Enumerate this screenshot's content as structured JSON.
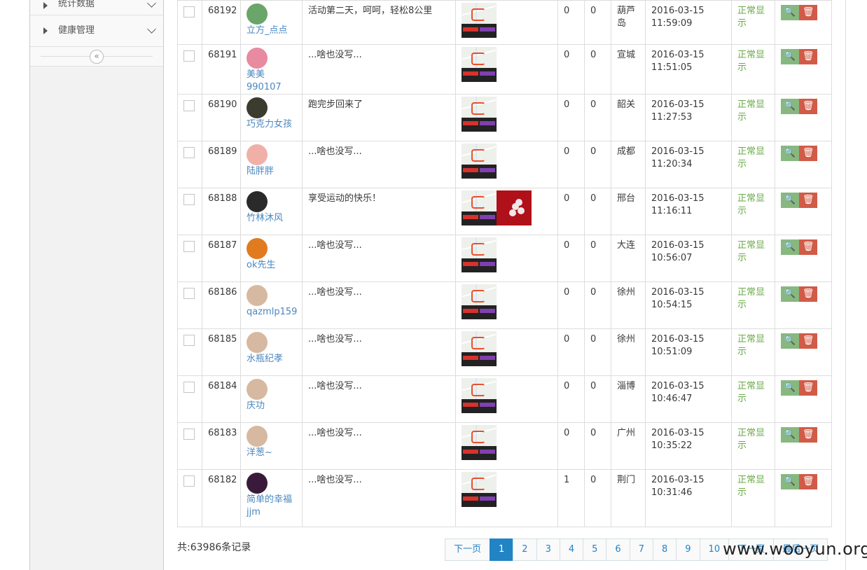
{
  "sidebar": {
    "items": [
      {
        "label": "统计数据"
      },
      {
        "label": "健康管理"
      }
    ],
    "collapse_glyph": "«"
  },
  "rows": [
    {
      "id": "68192",
      "user": "立方_点点",
      "content": "活动第二天，呵呵，轻松8公里",
      "c1": "0",
      "c2": "0",
      "city": "葫芦岛",
      "date": "2016-03-15",
      "time": "11:59:09",
      "status": "正常显示",
      "avatar_color": "#6aa56a",
      "extra_image": false
    },
    {
      "id": "68191",
      "user": "美美990107",
      "content": "...啥也没写...",
      "c1": "0",
      "c2": "0",
      "city": "宣城",
      "date": "2016-03-15",
      "time": "11:51:05",
      "status": "正常显示",
      "avatar_color": "#e88aa0",
      "extra_image": false
    },
    {
      "id": "68190",
      "user": "巧克力女孩",
      "content": "跑完步回来了",
      "c1": "0",
      "c2": "0",
      "city": "韶关",
      "date": "2016-03-15",
      "time": "11:27:53",
      "status": "正常显示",
      "avatar_color": "#3b3b2e",
      "extra_image": false
    },
    {
      "id": "68189",
      "user": "陆胖胖",
      "content": "...啥也没写...",
      "c1": "0",
      "c2": "0",
      "city": "成都",
      "date": "2016-03-15",
      "time": "11:20:34",
      "status": "正常显示",
      "avatar_color": "#f0b0a8",
      "extra_image": false
    },
    {
      "id": "68188",
      "user": "竹林沐风",
      "content": "享受运动的快乐！",
      "c1": "0",
      "c2": "0",
      "city": "邢台",
      "date": "2016-03-15",
      "time": "11:16:11",
      "status": "正常显示",
      "avatar_color": "#2a2a2a",
      "extra_image": true
    },
    {
      "id": "68187",
      "user": "ok先生",
      "content": "...啥也没写...",
      "c1": "0",
      "c2": "0",
      "city": "大连",
      "date": "2016-03-15",
      "time": "10:56:07",
      "status": "正常显示",
      "avatar_color": "#e07b20",
      "extra_image": false
    },
    {
      "id": "68186",
      "user": "qazmlp159",
      "content": "...啥也没写...",
      "c1": "0",
      "c2": "0",
      "city": "徐州",
      "date": "2016-03-15",
      "time": "10:54:15",
      "status": "正常显示",
      "avatar_color": "#d6b9a0",
      "extra_image": false
    },
    {
      "id": "68185",
      "user": "水瓶纪孝",
      "content": "...啥也没写...",
      "c1": "0",
      "c2": "0",
      "city": "徐州",
      "date": "2016-03-15",
      "time": "10:51:09",
      "status": "正常显示",
      "avatar_color": "#d6b9a0",
      "extra_image": false
    },
    {
      "id": "68184",
      "user": "庆功",
      "content": "...啥也没写...",
      "c1": "0",
      "c2": "0",
      "city": "淄博",
      "date": "2016-03-15",
      "time": "10:46:47",
      "status": "正常显示",
      "avatar_color": "#d6b9a0",
      "extra_image": false
    },
    {
      "id": "68183",
      "user": "洋葱~",
      "content": "...啥也没写...",
      "c1": "0",
      "c2": "0",
      "city": "广州",
      "date": "2016-03-15",
      "time": "10:35:22",
      "status": "正常显示",
      "avatar_color": "#d6b9a0",
      "extra_image": false
    },
    {
      "id": "68182",
      "user": "简单的幸福jjm",
      "content": "...啥也没写...",
      "c1": "1",
      "c2": "0",
      "city": "荆门",
      "date": "2016-03-15",
      "time": "10:31:46",
      "status": "正常显示",
      "avatar_color": "#3a1a3a",
      "extra_image": false
    }
  ],
  "actions": {
    "view_glyph": "🔍",
    "delete_glyph": "🗑"
  },
  "footer": {
    "total": "共:63986条记录",
    "pager": [
      "下一页",
      "1",
      "2",
      "3",
      "4",
      "5",
      "6",
      "7",
      "8",
      "9",
      "10",
      "下一页",
      "最后一页"
    ],
    "active_page": "1"
  },
  "watermark": "www.wooyun.org"
}
